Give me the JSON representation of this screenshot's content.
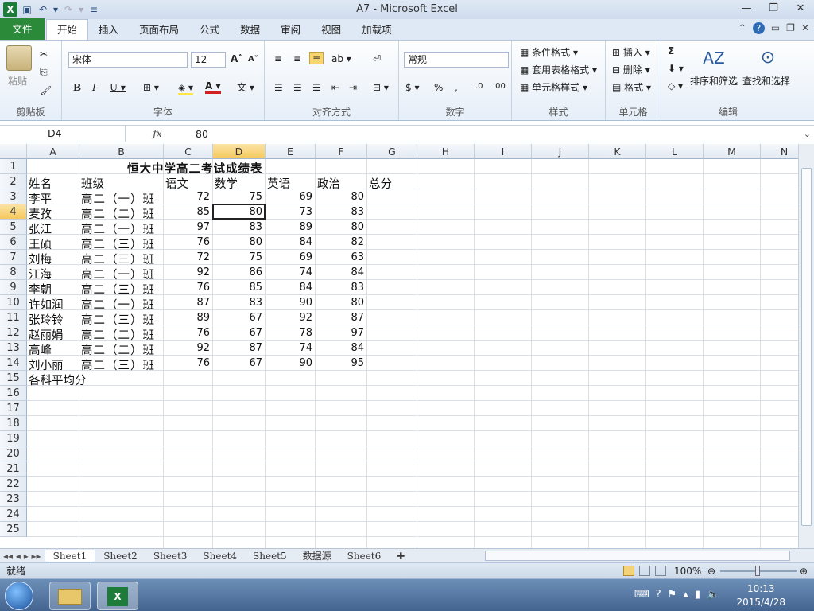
{
  "window": {
    "title": "A7 - Microsoft Excel"
  },
  "ribbon_tabs": [
    "文件",
    "开始",
    "插入",
    "页面布局",
    "公式",
    "数据",
    "审阅",
    "视图",
    "加载项"
  ],
  "ribbon": {
    "clipboard": {
      "label": "剪贴板",
      "paste": "粘贴"
    },
    "font": {
      "label": "字体",
      "name": "宋体",
      "size": "12"
    },
    "alignment": {
      "label": "对齐方式"
    },
    "number": {
      "label": "数字",
      "format": "常规"
    },
    "styles": {
      "label": "样式",
      "cond": "条件格式",
      "table": "套用表格格式",
      "cell": "单元格样式"
    },
    "cells": {
      "label": "单元格",
      "insert": "插入",
      "delete": "删除",
      "format": "格式"
    },
    "editing": {
      "label": "编辑",
      "sort": "排序和筛选",
      "find": "查找和选择",
      "sigma": "Σ"
    }
  },
  "formula_bar": {
    "name_box": "D4",
    "fx": "fx",
    "value": "80"
  },
  "columns": [
    "A",
    "B",
    "C",
    "D",
    "E",
    "F",
    "G",
    "H",
    "I",
    "J",
    "K",
    "L",
    "M",
    "N"
  ],
  "rows": [
    "1",
    "2",
    "3",
    "4",
    "5",
    "6",
    "7",
    "8",
    "9",
    "10",
    "11",
    "12",
    "13",
    "14",
    "15",
    "16",
    "17",
    "18",
    "19",
    "20",
    "21",
    "22",
    "23",
    "24",
    "25"
  ],
  "sheet": {
    "title": "恒大中学高二考试成绩表",
    "headers": [
      "姓名",
      "班级",
      "语文",
      "数学",
      "英语",
      "政治",
      "总分"
    ],
    "records": [
      {
        "name": "李平",
        "class": "高二（一）班",
        "c": "72",
        "d": "75",
        "e": "69",
        "f": "80"
      },
      {
        "name": "麦孜",
        "class": "高二（二）班",
        "c": "85",
        "d": "80",
        "e": "73",
        "f": "83"
      },
      {
        "name": "张江",
        "class": "高二（一）班",
        "c": "97",
        "d": "83",
        "e": "89",
        "f": "80"
      },
      {
        "name": "王硕",
        "class": "高二（三）班",
        "c": "76",
        "d": "80",
        "e": "84",
        "f": "82"
      },
      {
        "name": "刘梅",
        "class": "高二（三）班",
        "c": "72",
        "d": "75",
        "e": "69",
        "f": "63"
      },
      {
        "name": "江海",
        "class": "高二（一）班",
        "c": "92",
        "d": "86",
        "e": "74",
        "f": "84"
      },
      {
        "name": "李朝",
        "class": "高二（三）班",
        "c": "76",
        "d": "85",
        "e": "84",
        "f": "83"
      },
      {
        "name": "许如润",
        "class": "高二（一）班",
        "c": "87",
        "d": "83",
        "e": "90",
        "f": "80"
      },
      {
        "name": "张玲铃",
        "class": "高二（三）班",
        "c": "89",
        "d": "67",
        "e": "92",
        "f": "87"
      },
      {
        "name": "赵丽娟",
        "class": "高二（二）班",
        "c": "76",
        "d": "67",
        "e": "78",
        "f": "97"
      },
      {
        "name": "高峰",
        "class": "高二（二）班",
        "c": "92",
        "d": "87",
        "e": "74",
        "f": "84"
      },
      {
        "name": "刘小丽",
        "class": "高二（三）班",
        "c": "76",
        "d": "67",
        "e": "90",
        "f": "95"
      }
    ],
    "avg_label": "各科平均分"
  },
  "sheet_tabs": [
    "Sheet1",
    "Sheet2",
    "Sheet3",
    "Sheet4",
    "Sheet5",
    "数据源",
    "Sheet6"
  ],
  "status": {
    "ready": "就绪",
    "zoom": "100%"
  },
  "taskbar": {
    "time": "10:13",
    "date": "2015/4/28"
  }
}
